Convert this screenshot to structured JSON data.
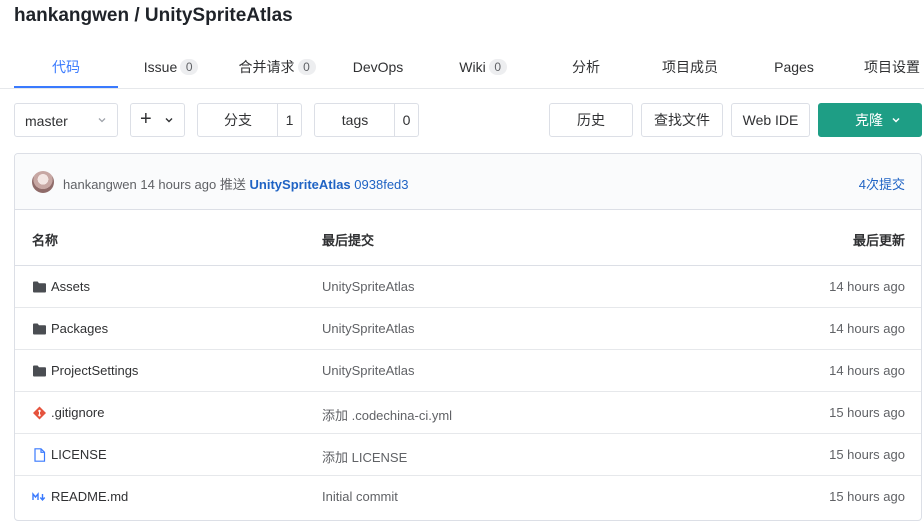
{
  "repo": {
    "title": "hankangwen / UnitySpriteAtlas"
  },
  "tabs": [
    {
      "label": "代码",
      "badge": ""
    },
    {
      "label": "Issue",
      "badge": "0"
    },
    {
      "label": "合并请求",
      "badge": "0"
    },
    {
      "label": "DevOps",
      "badge": ""
    },
    {
      "label": "Wiki",
      "badge": "0"
    },
    {
      "label": "分析",
      "badge": ""
    },
    {
      "label": "项目成员",
      "badge": ""
    },
    {
      "label": "Pages",
      "badge": ""
    },
    {
      "label": "项目设置",
      "badge": ""
    }
  ],
  "active_tab": "代码",
  "toolbar": {
    "branch": "master",
    "add_icon": "plus-icon",
    "branches_label": "分支",
    "branches_count": "1",
    "tags_label": "tags",
    "tags_count": "0",
    "history_label": "历史",
    "find_file_label": "查找文件",
    "web_ide_label": "Web IDE",
    "clone_label": "克隆"
  },
  "commit": {
    "author": "hankangwen",
    "time": "14 hours ago",
    "action": "推送",
    "repo": "UnitySpriteAtlas",
    "sha": "0938fed3",
    "count_label": "4次提交"
  },
  "table": {
    "headers": {
      "name": "名称",
      "last_commit": "最后提交",
      "last_updated": "最后更新"
    },
    "rows": [
      {
        "icon": "folder-icon",
        "name": "Assets",
        "commit": "UnitySpriteAtlas",
        "updated": "14 hours ago"
      },
      {
        "icon": "folder-icon",
        "name": "Packages",
        "commit": "UnitySpriteAtlas",
        "updated": "14 hours ago"
      },
      {
        "icon": "folder-icon",
        "name": "ProjectSettings",
        "commit": "UnitySpriteAtlas",
        "updated": "14 hours ago"
      },
      {
        "icon": "git-file-icon",
        "name": ".gitignore",
        "commit": "添加 .codechina-ci.yml",
        "updated": "15 hours ago"
      },
      {
        "icon": "file-icon",
        "name": "LICENSE",
        "commit": "添加 LICENSE",
        "updated": "15 hours ago"
      },
      {
        "icon": "markdown-icon",
        "name": "README.md",
        "commit": "Initial commit",
        "updated": "15 hours ago"
      }
    ]
  },
  "colors": {
    "accent": "#3a7afe",
    "link": "#1f63c4",
    "clone": "#1e9e85",
    "git_icon": "#e5533d",
    "file_icon": "#3a7afe"
  }
}
